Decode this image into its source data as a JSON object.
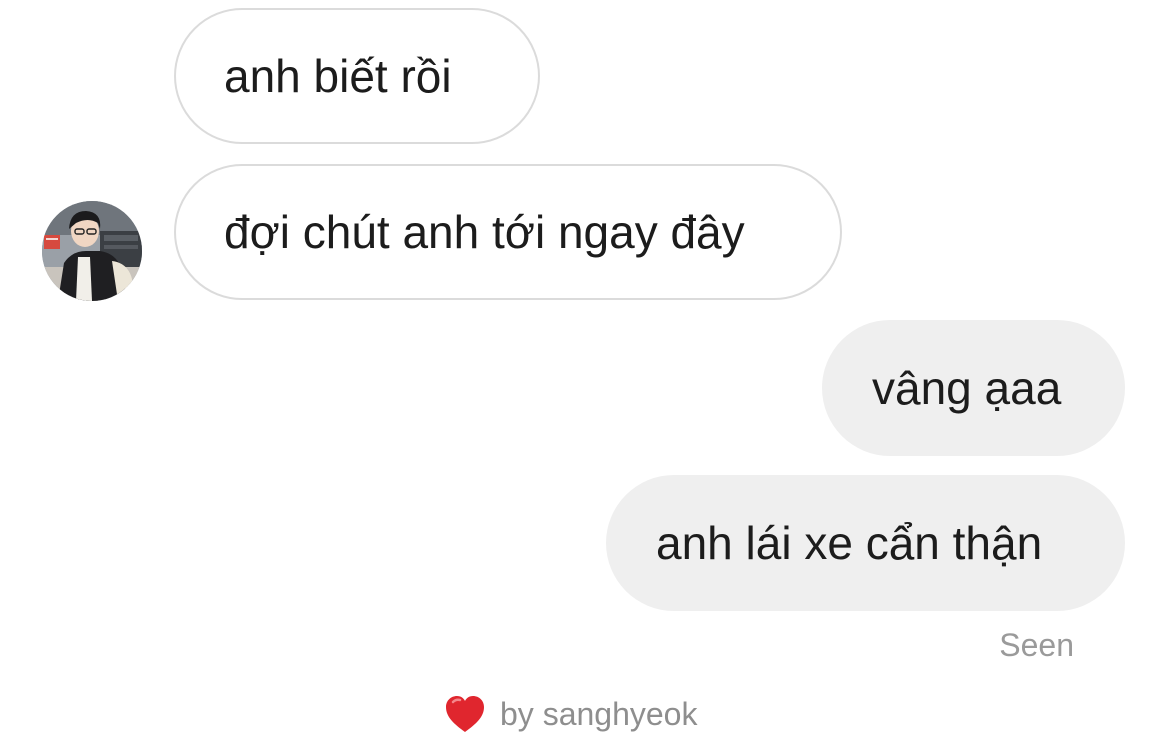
{
  "messages": [
    {
      "sender": "other",
      "text": "anh biết rồi"
    },
    {
      "sender": "other",
      "text": "đợi chút anh tới ngay đây"
    },
    {
      "sender": "me",
      "text": "vâng ạaa"
    },
    {
      "sender": "me",
      "text": "anh lái xe cẩn thận"
    }
  ],
  "status": {
    "seen": "Seen"
  },
  "reaction": {
    "icon": "heart-icon",
    "text": "by sanghyeok",
    "color": "#e0262e"
  },
  "colors": {
    "received_border": "#dbdbdb",
    "sent_background": "#efefef",
    "text": "#1c1c1c",
    "muted": "#9a9a9a"
  }
}
